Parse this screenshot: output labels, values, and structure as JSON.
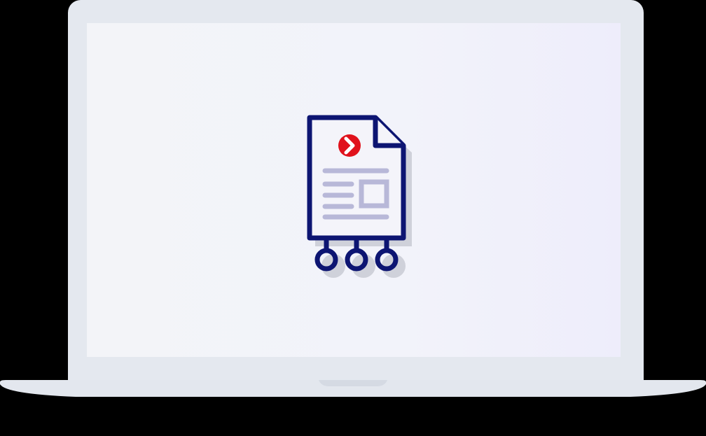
{
  "device": {
    "type": "laptop-mockup",
    "lid_color": "#e4e8ef",
    "screen_color": "#f3f4f8",
    "base_color": "#e3e7ee"
  },
  "screen": {
    "icon": {
      "name": "document-flow-icon",
      "badge_icon": "chevron-right-icon",
      "colors": {
        "outline": "#0d1572",
        "badge": "#e0121c",
        "lines": "#b8b8d8",
        "shadow": "#cfd1da",
        "paper": "#f4f4fa"
      }
    }
  }
}
